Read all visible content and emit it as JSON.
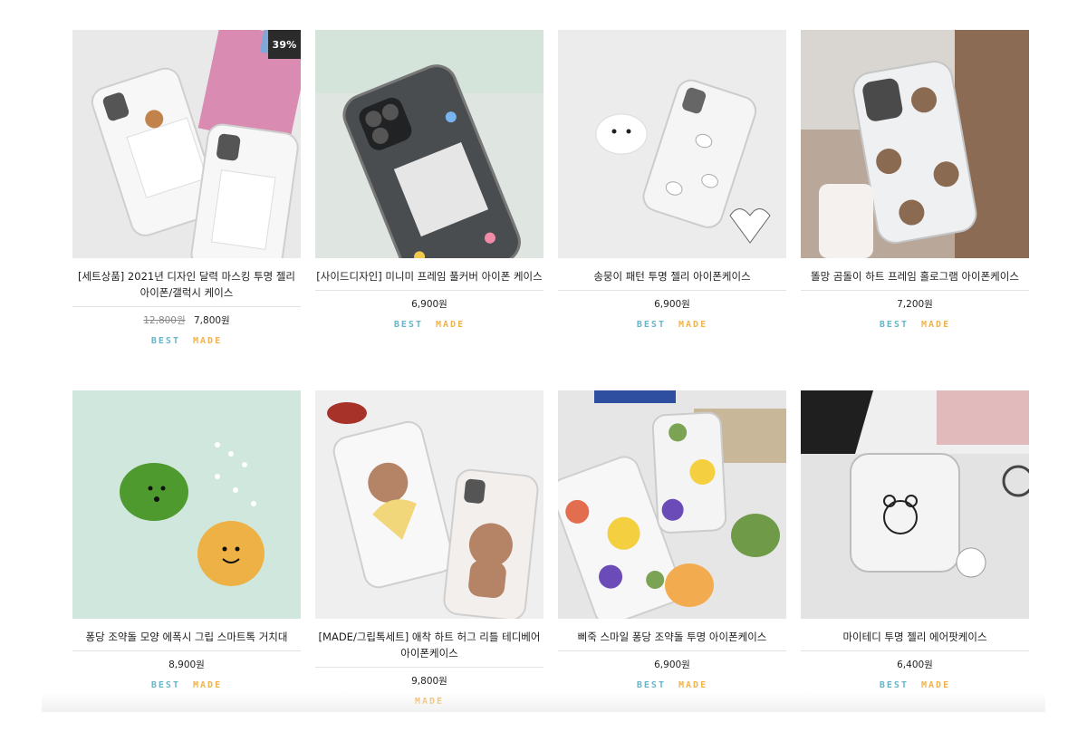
{
  "tags": {
    "best": "BEST",
    "made": "MADE"
  },
  "products": [
    {
      "name": "[세트상품] 2021년 디자인 달력 마스킹 투명 젤리 아이폰/갤럭시 케이스",
      "discount": "39%",
      "old_price": "12,800원",
      "price": "7,800원",
      "image_icon": "phone-case-calendar-image",
      "colors": {
        "bg": "#e9e9ea",
        "accent": "#d46aa0"
      }
    },
    {
      "name": "[사이드디자인] 미니미 프레임 풀커버 아이폰 케이스",
      "price": "6,900원",
      "image_icon": "phone-case-frame-image",
      "colors": {
        "bg": "#dfe6e1",
        "accent": "#3f4345"
      }
    },
    {
      "name": "송뭉이 패턴 투명 젤리 아이폰케이스",
      "price": "6,900원",
      "image_icon": "phone-case-puppy-image",
      "colors": {
        "bg": "#ececec",
        "accent": "#ffffff"
      }
    },
    {
      "name": "똘망 곰돌이 하트 프레임 홀로그램 아이폰케이스",
      "price": "7,200원",
      "image_icon": "phone-case-bear-hologram-image",
      "colors": {
        "bg": "#b9a79a",
        "accent": "#8b6a52"
      }
    },
    {
      "name": "퐁당 조약돌 모양 에폭시 그립 스마트톡 거치대",
      "price": "8,900원",
      "image_icon": "pebble-grip-image",
      "colors": {
        "bg": "#cfe7dc",
        "accent": "#4e9a2e"
      }
    },
    {
      "name": "[MADE/그립톡세트] 애착 하트 허그 리틀 테디베어 아이폰케이스",
      "price": "9,800원",
      "image_icon": "teddy-bear-case-image",
      "colors": {
        "bg": "#efefef",
        "accent": "#a8755b"
      },
      "made_only": true
    },
    {
      "name": "삐죽 스마일 퐁당 조약돌 투명 아이폰케이스",
      "price": "6,900원",
      "image_icon": "smile-pebble-case-image",
      "colors": {
        "bg": "#e6e6e6",
        "accent": "#f4cf3f"
      }
    },
    {
      "name": "마이테디 투명 젤리 에어팟케이스",
      "price": "6,400원",
      "image_icon": "airpods-case-image",
      "colors": {
        "bg": "#e3e3e3",
        "accent": "#333333"
      }
    }
  ]
}
